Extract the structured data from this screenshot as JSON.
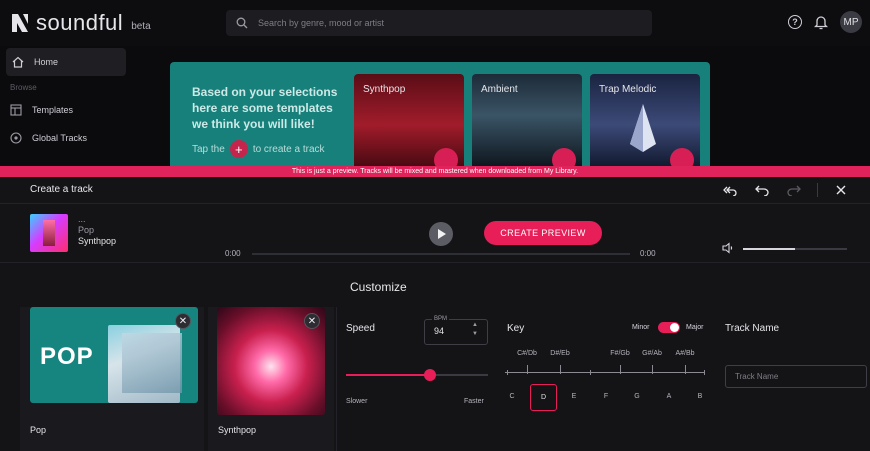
{
  "app": {
    "logo_text": "soundful",
    "logo_badge": "beta",
    "search_placeholder": "Search by genre, mood or artist",
    "help_icon": "question-circle-icon",
    "bell_icon": "bell-icon",
    "avatar_initials": "MP"
  },
  "sidebar": {
    "home_label": "Home",
    "section_label": "Browse",
    "templates_label": "Templates",
    "global_tracks_label": "Global Tracks"
  },
  "banner": {
    "text": "Based on your selections here are some templates we think you will like!",
    "tap_prefix": "Tap the",
    "tap_suffix": "to create a track",
    "templates": [
      {
        "name": "Synthpop"
      },
      {
        "name": "Ambient"
      },
      {
        "name": "Trap Melodic"
      }
    ]
  },
  "preview_notice": "This is just a preview. Tracks will be mixed and mastered when downloaded from My Library.",
  "modal": {
    "title": "Create a track",
    "actions": {
      "undo_all_icon": "undo-all-icon",
      "undo_icon": "undo-icon",
      "redo_icon": "redo-icon",
      "close_icon": "close-icon"
    }
  },
  "player": {
    "track_title": "...",
    "genre": "Pop",
    "template": "Synthpop",
    "create_preview_label": "CREATE PREVIEW",
    "time_current": "0:00",
    "time_total": "0:00",
    "playback_progress": 0,
    "volume": 0.5
  },
  "customize": {
    "title": "Customize",
    "cards": [
      {
        "label": "Pop",
        "art_text": "POP"
      },
      {
        "label": "Synthpop"
      }
    ],
    "speed": {
      "label": "Speed",
      "bpm_caption": "BPM",
      "bpm_value": "94",
      "slider_fraction": 0.59,
      "slower_label": "Slower",
      "faster_label": "Faster"
    },
    "key": {
      "label": "Key",
      "minor_label": "Minor",
      "major_label": "Major",
      "mode": "Major",
      "sharps": [
        "C#/Db",
        "D#/Eb",
        "F#/Gb",
        "G#/Ab",
        "A#/Bb"
      ],
      "notes": [
        "C",
        "D",
        "E",
        "F",
        "G",
        "A",
        "B"
      ],
      "selected_note": "D"
    },
    "track_name": {
      "label": "Track Name",
      "placeholder": "Track Name",
      "value": ""
    }
  },
  "colors": {
    "accent": "#e81e58",
    "banner_teal": "#17807a",
    "modal_bg": "#141417"
  }
}
